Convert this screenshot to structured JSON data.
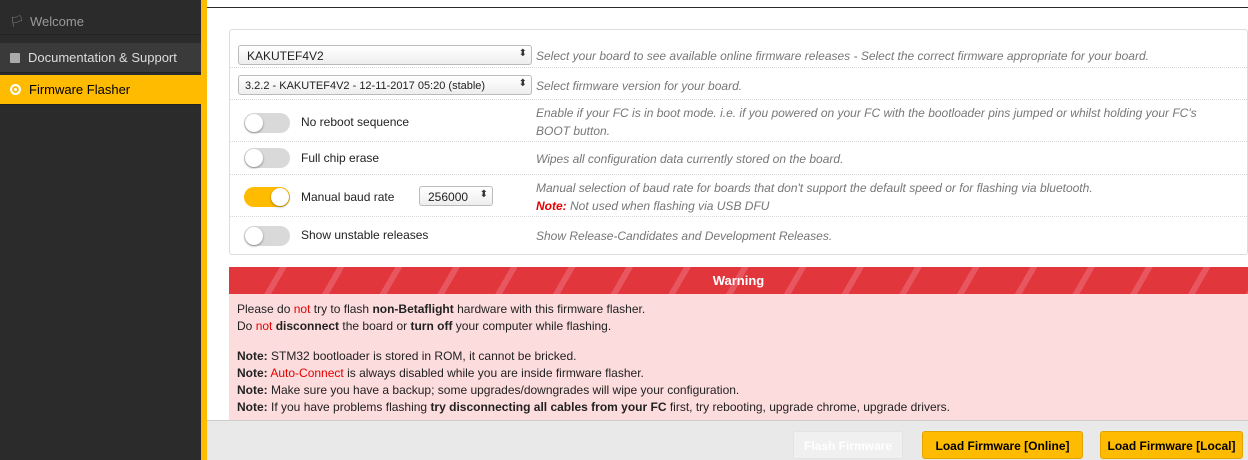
{
  "sidebar": {
    "items": [
      {
        "label": "Welcome",
        "icon": "welcome-icon"
      },
      {
        "label": "Documentation & Support",
        "icon": "document-icon"
      },
      {
        "label": "Firmware Flasher",
        "icon": "chip-icon"
      }
    ],
    "active_color": "#ffbb00"
  },
  "options": {
    "board": {
      "value": "KAKUTEF4V2",
      "desc": "Select your board to see available online firmware releases - Select the correct firmware appropriate for your board."
    },
    "version": {
      "value": "3.2.2 - KAKUTEF4V2 - 12-11-2017 05:20 (stable)",
      "desc": "Select firmware version for your board."
    },
    "no_reboot": {
      "label": "No reboot sequence",
      "on": false,
      "desc_1": "Enable if your FC is in boot mode. i.e. if you powered on your FC with the bootloader pins jumped or whilst holding your FC's",
      "desc_2": "BOOT button."
    },
    "full_chip_erase": {
      "label": "Full chip erase",
      "on": false,
      "desc": "Wipes all configuration data currently stored on the board."
    },
    "manual_baud": {
      "label": "Manual baud rate",
      "on": true,
      "baud_value": "256000",
      "desc_1": "Manual selection of baud rate for boards that don't support the default speed or for flashing via bluetooth.",
      "note_label": "Note:",
      "note_text": "Not used when flashing via USB DFU"
    },
    "unstable": {
      "label": "Show unstable releases",
      "on": false,
      "desc": "Show Release-Candidates and Development Releases."
    }
  },
  "warning": {
    "title": "Warning",
    "line1": {
      "a": "Please do ",
      "not": "not",
      "b": " try to flash ",
      "bold": "non-Betaflight",
      "c": " hardware with this firmware flasher."
    },
    "line2": {
      "a": "Do ",
      "not": "not",
      "bold1": " disconnect",
      "b": " the board or ",
      "bold2": "turn off",
      "c": " your computer while flashing."
    },
    "note_label": "Note:",
    "note1": " STM32 bootloader is stored in ROM, it cannot be bricked.",
    "note2": {
      "red": "Auto-Connect",
      "text": " is always disabled while you are inside firmware flasher."
    },
    "note3": " Make sure you have a backup; some upgrades/downgrades will wipe your configuration.",
    "note4": {
      "a": " If you have problems flashing ",
      "bold": "try disconnecting all cables from your FC",
      "b": " first, try rebooting, upgrade chrome, upgrade drivers."
    }
  },
  "buttons": {
    "flash": "Flash Firmware",
    "load_online": "Load Firmware [Online]",
    "load_local": "Load Firmware [Local]"
  }
}
